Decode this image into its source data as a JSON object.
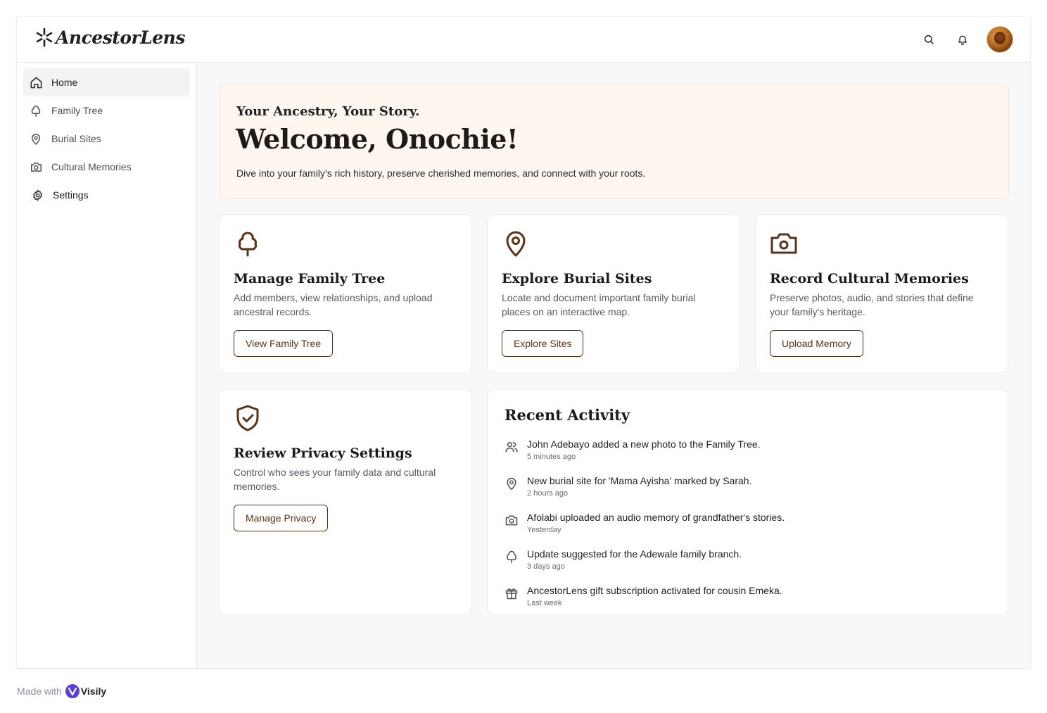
{
  "app": {
    "name": "AncestorLens"
  },
  "topbar": {
    "search_icon": "search-icon",
    "bell_icon": "bell-icon",
    "avatar": "user-avatar"
  },
  "sidebar": {
    "items": [
      {
        "label": "Home",
        "icon": "home-icon",
        "active": true
      },
      {
        "label": "Family Tree",
        "icon": "tree-icon",
        "active": false
      },
      {
        "label": "Burial Sites",
        "icon": "map-pin-icon",
        "active": false
      },
      {
        "label": "Cultural Memories",
        "icon": "camera-icon",
        "active": false
      },
      {
        "label": "Settings",
        "icon": "gear-icon",
        "active": false
      }
    ]
  },
  "hero": {
    "subtitle": "Your Ancestry, Your Story.",
    "title": "Welcome, Onochie!",
    "description": "Dive into your family's rich history, preserve cherished memories, and connect with your roots."
  },
  "cards": [
    {
      "icon": "tree-icon",
      "title": "Manage Family Tree",
      "description": "Add members, view relationships, and upload ancestral records.",
      "button": "View Family Tree"
    },
    {
      "icon": "map-pin-icon",
      "title": "Explore Burial Sites",
      "description": "Locate and document important family burial places on an interactive map.",
      "button": "Explore Sites"
    },
    {
      "icon": "camera-icon",
      "title": "Record Cultural Memories",
      "description": "Preserve photos, audio, and stories that define your family's heritage.",
      "button": "Upload Memory"
    },
    {
      "icon": "shield-check-icon",
      "title": "Review Privacy Settings",
      "description": "Control who sees your family data and cultural memories.",
      "button": "Manage Privacy"
    }
  ],
  "activity": {
    "title": "Recent Activity",
    "items": [
      {
        "icon": "users-icon",
        "text": "John Adebayo added a new photo to the Family Tree.",
        "time": "5 minutes ago"
      },
      {
        "icon": "map-pin-icon",
        "text": "New burial site for 'Mama Ayisha' marked by Sarah.",
        "time": "2 hours ago"
      },
      {
        "icon": "camera-icon",
        "text": "Afolabi uploaded an audio memory of grandfather's stories.",
        "time": "Yesterday"
      },
      {
        "icon": "tree-icon",
        "text": "Update suggested for the Adewale family branch.",
        "time": "3 days ago"
      },
      {
        "icon": "gift-icon",
        "text": "AncestorLens gift subscription activated for cousin Emeka.",
        "time": "Last week"
      }
    ]
  },
  "footer": {
    "made_with": "Made with",
    "brand": "Visily"
  },
  "colors": {
    "accent": "#5a3314",
    "hero_bg": "#fff6f0",
    "nav_active_bg": "#f2f3f5",
    "page_bg": "#f8f8f8"
  }
}
